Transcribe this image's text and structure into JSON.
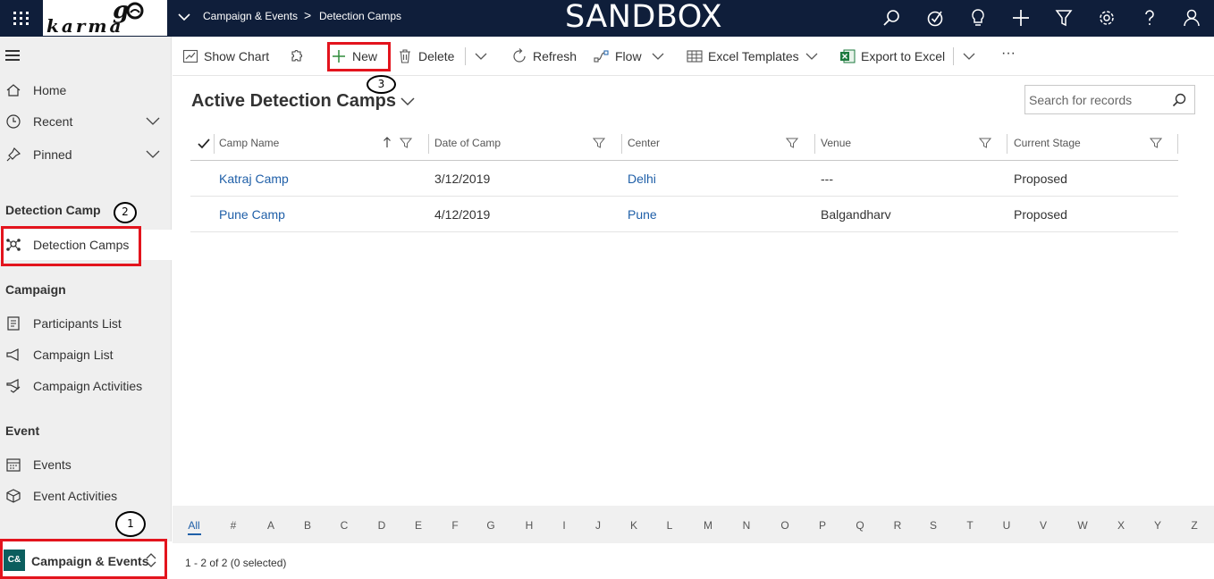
{
  "topbar": {
    "breadcrumb_area": "Campaign & Events",
    "breadcrumb_separator": ">",
    "breadcrumb_page": "Detection Camps",
    "environment_title": "SANDBOX",
    "logo_text": "go karma",
    "icons": [
      "search-icon",
      "task-check-icon",
      "lightbulb-icon",
      "plus-icon",
      "filter-icon",
      "gear-icon",
      "help-icon",
      "user-icon"
    ]
  },
  "sidebar": {
    "home": "Home",
    "recent": "Recent",
    "pinned": "Pinned",
    "section_detection": "Detection Camp",
    "detection_camps": "Detection Camps",
    "section_campaign": "Campaign",
    "participants_list": "Participants List",
    "campaign_list": "Campaign List",
    "campaign_activities": "Campaign Activities",
    "section_event": "Event",
    "events": "Events",
    "event_activities": "Event Activities",
    "area_badge": "C&",
    "area_label": "Campaign & Events"
  },
  "callouts": {
    "one": "1",
    "two": "2",
    "three": "3"
  },
  "commandbar": {
    "show_chart": "Show Chart",
    "new": "New",
    "delete": "Delete",
    "refresh": "Refresh",
    "flow": "Flow",
    "excel_templates": "Excel Templates",
    "export_to_excel": "Export to Excel",
    "more": "···"
  },
  "view": {
    "title": "Active Detection Camps",
    "search_placeholder": "Search for records"
  },
  "grid": {
    "columns": [
      "Camp Name",
      "Date of Camp",
      "Center",
      "Venue",
      "Current Stage"
    ],
    "rows": [
      {
        "camp_name": "Katraj Camp",
        "date": "3/12/2019",
        "center": "Delhi",
        "venue": "---",
        "stage": "Proposed"
      },
      {
        "camp_name": "Pune Camp",
        "date": "4/12/2019",
        "center": "Pune",
        "venue": "Balgandharv",
        "stage": "Proposed"
      }
    ]
  },
  "jumpbar": [
    "All",
    "#",
    "A",
    "B",
    "C",
    "D",
    "E",
    "F",
    "G",
    "H",
    "I",
    "J",
    "K",
    "L",
    "M",
    "N",
    "O",
    "P",
    "Q",
    "R",
    "S",
    "T",
    "U",
    "V",
    "W",
    "X",
    "Y",
    "Z"
  ],
  "footer": {
    "status": "1 - 2 of 2 (0 selected)"
  },
  "colors": {
    "topbar": "#0f1e3a",
    "link": "#1f5fa8",
    "highlight": "#e3141d",
    "area_badge": "#0b5e5e"
  }
}
